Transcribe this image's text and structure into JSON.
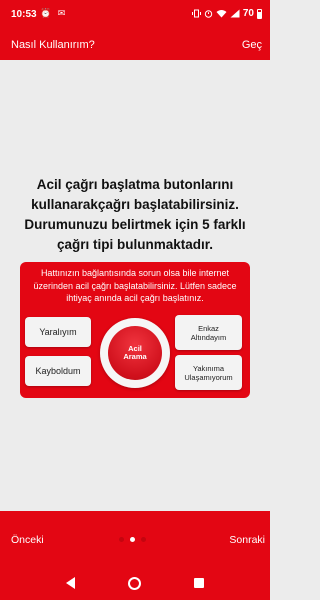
{
  "status_bar": {
    "time": "10:53",
    "left_icons": "⏰ ✉",
    "battery": "70"
  },
  "header": {
    "title": "Nasıl Kullanırım?",
    "skip": "Geç"
  },
  "intro": {
    "text": "Acil çağrı başlatma butonlarını kullanarakçağrı başlatabilirsiniz. Durumunuzu belirtmek için 5 farklı çağrı tipi bulunmaktadır."
  },
  "card": {
    "text": "Hattınızın bağlantısında sorun olsa bile internet üzerinden acil çağrı başlatabilirsiniz. Lütfen sadece ihtiyaç anında acil çağrı başlatınız.",
    "buttons": {
      "yaraliyim": "Yaralıyım",
      "kayboldum": "Kayboldum",
      "enkaz_line1": "Enkaz",
      "enkaz_line2": "Altındayım",
      "yakinima_line1": "Yakınıma",
      "yakinima_line2": "Ulaşamıyorum",
      "acil_line1": "Acil",
      "acil_line2": "Arama"
    }
  },
  "nav": {
    "prev": "Önceki",
    "next": "Sonraki",
    "page_count": 3,
    "active_page": 2
  },
  "colors": {
    "brand_red": "#e30613",
    "background": "#ececec"
  }
}
